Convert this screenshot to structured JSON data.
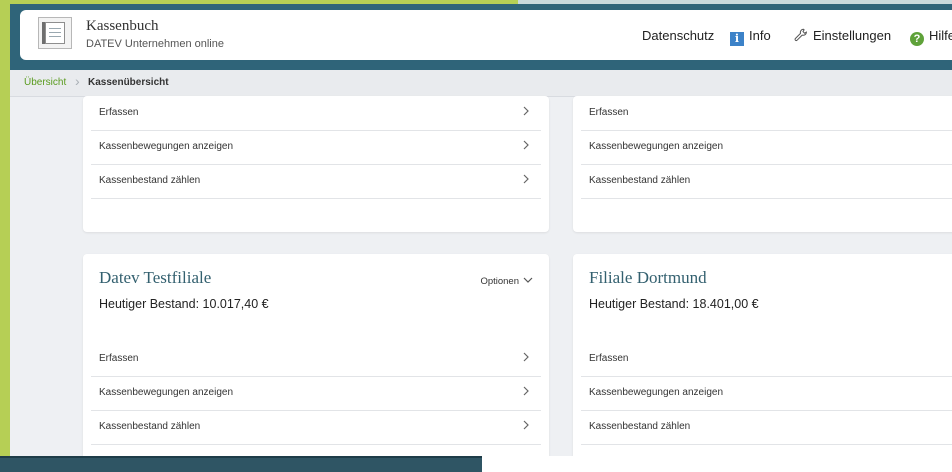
{
  "header": {
    "app_title": "Kassenbuch",
    "app_subtitle": "DATEV Unternehmen online",
    "links": {
      "privacy": "Datenschutz",
      "info": "Info",
      "settings": "Einstellungen",
      "help": "Hilfe"
    },
    "icons": [
      "cashbook-logo-icon",
      "info-icon",
      "wrench-icon",
      "help-icon"
    ]
  },
  "breadcrumb": {
    "root": "Übersicht",
    "current": "Kassenübersicht"
  },
  "actions": {
    "enter": "Erfassen",
    "show_movements": "Kassenbewegungen anzeigen",
    "count_balance": "Kassenbestand zählen"
  },
  "cards": [
    {
      "title": "Datev Testfiliale",
      "balance": "Heutiger Bestand: 10.017,40 €",
      "options_label": "Optionen"
    },
    {
      "title": "Filiale Dortmund",
      "balance": "Heutiger Bestand: 18.401,00 €"
    }
  ],
  "colors": {
    "accent_green": "#b6cf55",
    "banner_teal": "#2f6479",
    "link_green": "#5a9b1e",
    "title_teal": "#33606f"
  }
}
